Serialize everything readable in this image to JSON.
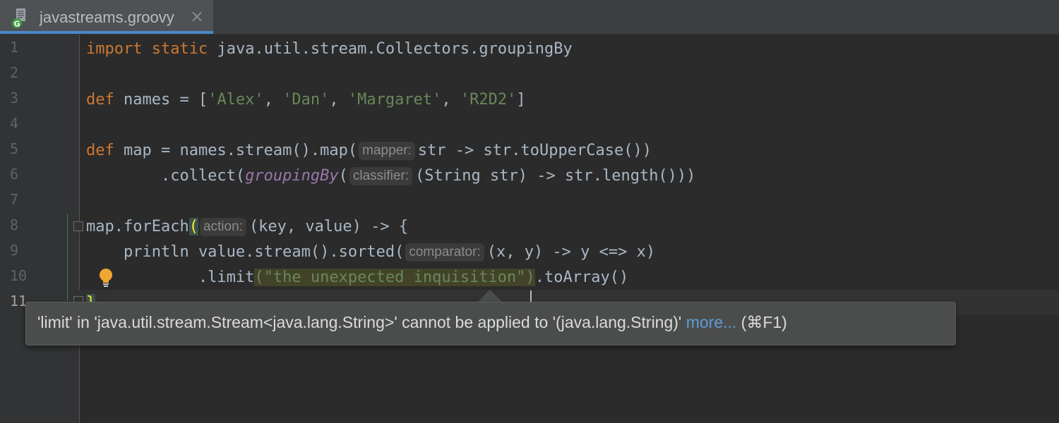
{
  "tab": {
    "title": "javastreams.groovy",
    "icon": "groovy-file-icon",
    "icon_letter": "G"
  },
  "gutter": {
    "line_numbers": [
      "1",
      "2",
      "3",
      "4",
      "5",
      "6",
      "7",
      "8",
      "9",
      "10",
      "11"
    ],
    "current_line": "11"
  },
  "code": {
    "line1": {
      "kw1": "import",
      "kw2": "static",
      "rest": " java.util.stream.Collectors.groupingBy"
    },
    "line3": {
      "kw": "def",
      "pre": " names = [",
      "s1": "'Alex'",
      "c1": ", ",
      "s2": "'Dan'",
      "c2": ", ",
      "s3": "'Margaret'",
      "c3": ", ",
      "s4": "'R2D2'",
      "post": "]"
    },
    "line5": {
      "kw": "def",
      "pre": " map = names.stream().map(",
      "hint": "mapper:",
      "post": "str -> str.toUpperCase())"
    },
    "line6": {
      "pre": "        .collect(",
      "fn": "groupingBy",
      "paren": "(",
      "hint": "classifier:",
      "post": "(String str) -> str.length()))"
    },
    "line8": {
      "pre": "map.forEach",
      "brace": "(",
      "hint": "action:",
      "post": "(key, value) -> {"
    },
    "line9": {
      "pre": "    println value.stream().sorted(",
      "hint": "comparator:",
      "post": "(x, y) -> y <=> x)"
    },
    "line10": {
      "pre": "            .limit",
      "arg": "(\"the unexpected inquisition\")",
      "post": ".toArray()"
    },
    "line11": {
      "text": "}"
    }
  },
  "tooltip": {
    "message": "'limit' in 'java.util.stream.Stream<java.lang.String>' cannot be applied to '(java.lang.String)' ",
    "link": "more...",
    "shortcut": " (⌘F1)"
  },
  "colors": {
    "keyword": "#cc7832",
    "string": "#6a8759",
    "static_method": "#9876aa",
    "link": "#5d9ed6"
  }
}
